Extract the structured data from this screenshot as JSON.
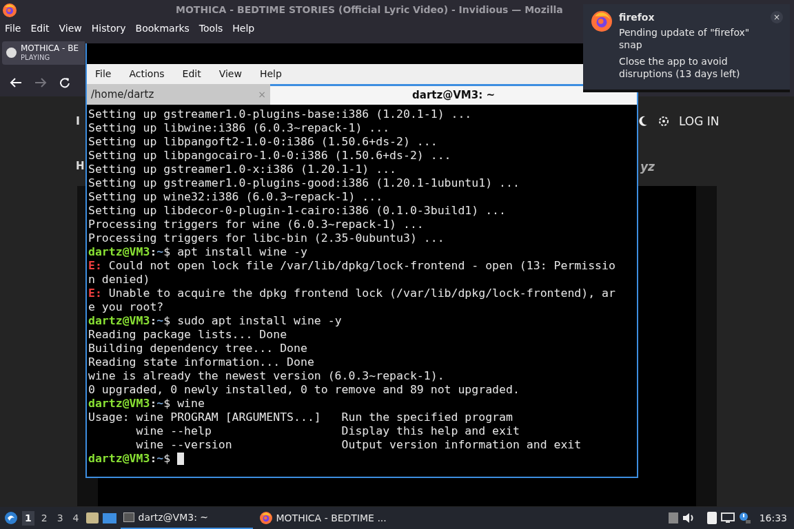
{
  "browser": {
    "title": "MOTHICA - BEDTIME STORIES (Official Lyric Video) - Invidious — Mozilla",
    "menu": [
      "File",
      "Edit",
      "View",
      "History",
      "Bookmarks",
      "Tools",
      "Help"
    ],
    "tab": {
      "title": "MOTHICA - BE",
      "status": "PLAYING"
    },
    "page": {
      "logo": "I",
      "heading": "H",
      "heading_tail": "yz",
      "login": "LOG IN"
    }
  },
  "terminal": {
    "menu": [
      "File",
      "Actions",
      "Edit",
      "View",
      "Help"
    ],
    "tabs": [
      {
        "label": "/home/dartz",
        "selected": false,
        "close": "×"
      },
      {
        "label": "dartz@VM3: ~",
        "selected": true
      }
    ],
    "lines": [
      {
        "kind": "plain",
        "text": "Setting up gstreamer1.0-plugins-base:i386 (1.20.1-1) ..."
      },
      {
        "kind": "plain",
        "text": "Setting up libwine:i386 (6.0.3~repack-1) ..."
      },
      {
        "kind": "plain",
        "text": "Setting up libpangoft2-1.0-0:i386 (1.50.6+ds-2) ..."
      },
      {
        "kind": "plain",
        "text": "Setting up libpangocairo-1.0-0:i386 (1.50.6+ds-2) ..."
      },
      {
        "kind": "plain",
        "text": "Setting up gstreamer1.0-x:i386 (1.20.1-1) ..."
      },
      {
        "kind": "plain",
        "text": "Setting up gstreamer1.0-plugins-good:i386 (1.20.1-1ubuntu1) ..."
      },
      {
        "kind": "plain",
        "text": "Setting up wine32:i386 (6.0.3~repack-1) ..."
      },
      {
        "kind": "plain",
        "text": "Setting up libdecor-0-plugin-1-cairo:i386 (0.1.0-3build1) ..."
      },
      {
        "kind": "plain",
        "text": "Processing triggers for wine (6.0.3~repack-1) ..."
      },
      {
        "kind": "plain",
        "text": "Processing triggers for libc-bin (2.35-0ubuntu3) ..."
      },
      {
        "kind": "prompt",
        "user": "dartz@VM3",
        "sep": ":",
        "path": "~",
        "text": "$ apt install wine -y"
      },
      {
        "kind": "error",
        "tag": "E:",
        "text": " Could not open lock file /var/lib/dpkg/lock-frontend - open (13: Permissio"
      },
      {
        "kind": "plain",
        "text": "n denied)"
      },
      {
        "kind": "error",
        "tag": "E:",
        "text": " Unable to acquire the dpkg frontend lock (/var/lib/dpkg/lock-frontend), ar"
      },
      {
        "kind": "plain",
        "text": "e you root?"
      },
      {
        "kind": "prompt",
        "user": "dartz@VM3",
        "sep": ":",
        "path": "~",
        "text": "$ sudo apt install wine -y"
      },
      {
        "kind": "plain",
        "text": "Reading package lists... Done"
      },
      {
        "kind": "plain",
        "text": "Building dependency tree... Done"
      },
      {
        "kind": "plain",
        "text": "Reading state information... Done"
      },
      {
        "kind": "plain",
        "text": "wine is already the newest version (6.0.3~repack-1)."
      },
      {
        "kind": "plain",
        "text": "0 upgraded, 0 newly installed, 0 to remove and 89 not upgraded."
      },
      {
        "kind": "prompt",
        "user": "dartz@VM3",
        "sep": ":",
        "path": "~",
        "text": "$ wine"
      },
      {
        "kind": "plain",
        "text": "Usage: wine PROGRAM [ARGUMENTS...]   Run the specified program"
      },
      {
        "kind": "plain",
        "text": "       wine --help                   Display this help and exit"
      },
      {
        "kind": "plain",
        "text": "       wine --version                Output version information and exit"
      },
      {
        "kind": "prompt",
        "user": "dartz@VM3",
        "sep": ":",
        "path": "~",
        "text": "$ ",
        "cursor": true
      }
    ]
  },
  "notification": {
    "app": "firefox",
    "summary": "Pending update of \"firefox\" snap",
    "body": "Close the app to avoid disruptions (13 days left)",
    "close": "×"
  },
  "taskbar": {
    "workspaces": [
      {
        "label": "1",
        "selected": true
      },
      {
        "label": "2",
        "selected": false
      },
      {
        "label": "3",
        "selected": false
      },
      {
        "label": "4",
        "selected": false
      }
    ],
    "tasks": [
      {
        "label": "dartz@VM3: ~",
        "kind": "terminal",
        "selected": true
      },
      {
        "label": "MOTHICA - BEDTIME ...",
        "kind": "firefox",
        "selected": false
      }
    ],
    "clock": "16:33"
  }
}
